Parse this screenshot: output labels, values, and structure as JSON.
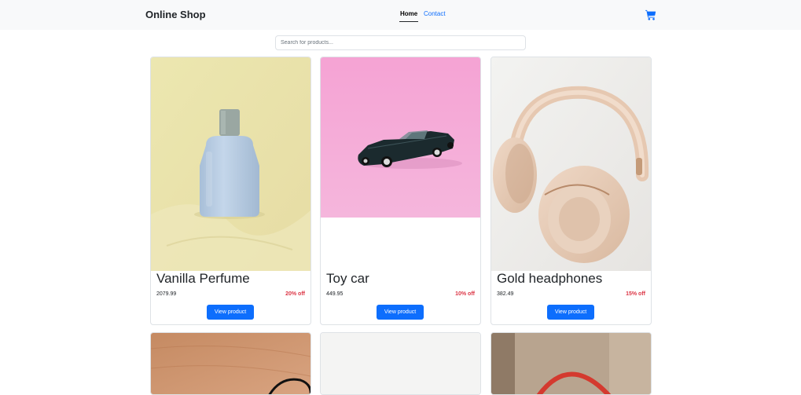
{
  "navbar": {
    "brand": "Online Shop",
    "links": [
      {
        "label": "Home",
        "active": true
      },
      {
        "label": "Contact",
        "active": false
      }
    ],
    "cart_icon": "shopping-cart-icon"
  },
  "search": {
    "placeholder": "Search for products..."
  },
  "products": [
    {
      "name": "Vanilla Perfume",
      "price": "2079.99",
      "discount": "20% off",
      "button": "View product"
    },
    {
      "name": "Toy car",
      "price": "449.95",
      "discount": "10% off",
      "button": "View product"
    },
    {
      "name": "Gold headphones",
      "price": "382.49",
      "discount": "15% off",
      "button": "View product"
    }
  ],
  "colors": {
    "primary": "#0d6efd",
    "discount": "#dc3545",
    "navbar_bg": "#f8f9fa"
  }
}
